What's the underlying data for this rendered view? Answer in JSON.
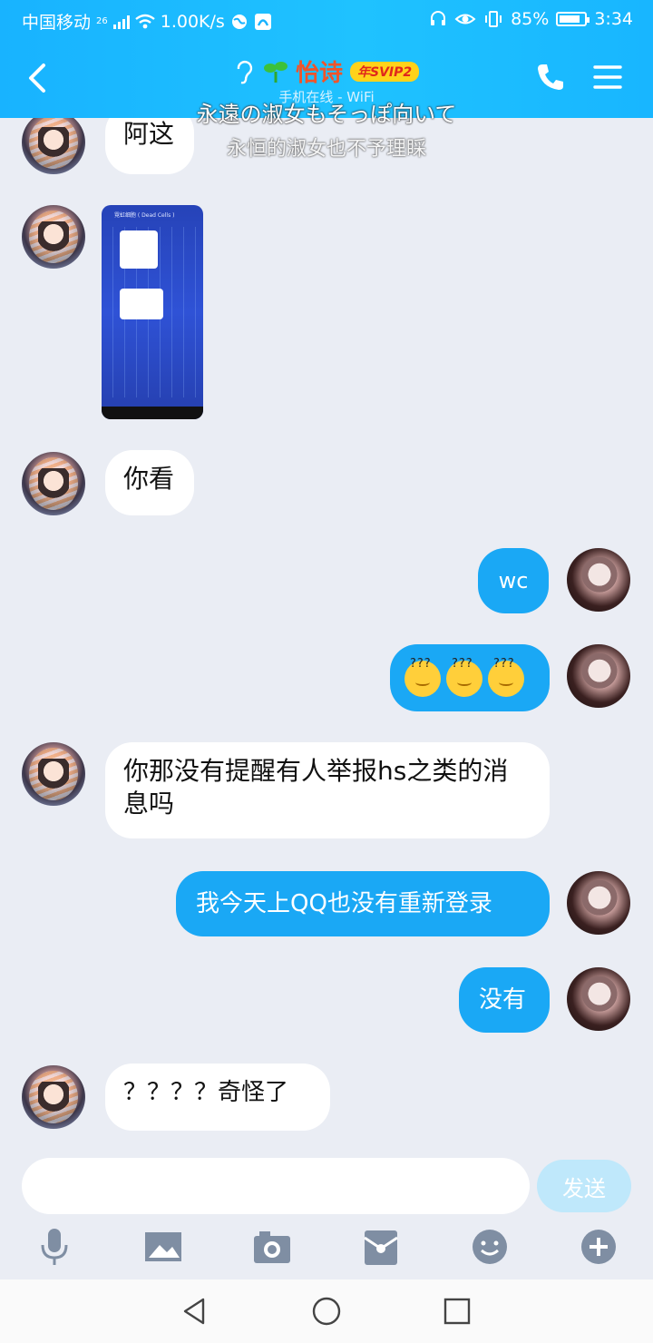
{
  "status": {
    "carrier": "中国移动",
    "network_tag": "26",
    "speed": "1.00K/s",
    "battery": "85%",
    "battery_level": 0.85,
    "time": "3:34"
  },
  "header": {
    "title": "怡诗",
    "vip_badge": "年SVIP2",
    "subtitle": "手机在线 - WiFi"
  },
  "overlay_subtitles": {
    "japanese": "永遠の淑女もそっぽ向いて",
    "chinese": "永恒的淑女也不予理睬"
  },
  "messages": [
    {
      "from": "friend",
      "type": "text",
      "text": "阿这"
    },
    {
      "from": "friend",
      "type": "image",
      "text": "霓虹细胞 ( Dead Cells )"
    },
    {
      "from": "friend",
      "type": "text",
      "text": "你看"
    },
    {
      "from": "me",
      "type": "text",
      "text": "wc"
    },
    {
      "from": "me",
      "type": "emoji",
      "text": "???"
    },
    {
      "from": "friend",
      "type": "text",
      "text": "你那没有提醒有人举报hs之类的消息吗"
    },
    {
      "from": "me",
      "type": "text",
      "text": "我今天上QQ也没有重新登录"
    },
    {
      "from": "me",
      "type": "text",
      "text": "没有"
    },
    {
      "from": "friend",
      "type": "text",
      "text": "？？？？奇怪了"
    }
  ],
  "composer": {
    "placeholder": "",
    "send_label": "发送"
  },
  "toolbar_icons": [
    "microphone-icon",
    "image-icon",
    "camera-icon",
    "red-packet-icon",
    "emoji-icon",
    "plus-icon"
  ],
  "colors": {
    "header_gradient": "#1fc2ff",
    "outgoing_bubble": "#1aa8f5",
    "incoming_bubble": "#ffffff",
    "background": "#eaedf4",
    "title": "#f0542a"
  }
}
